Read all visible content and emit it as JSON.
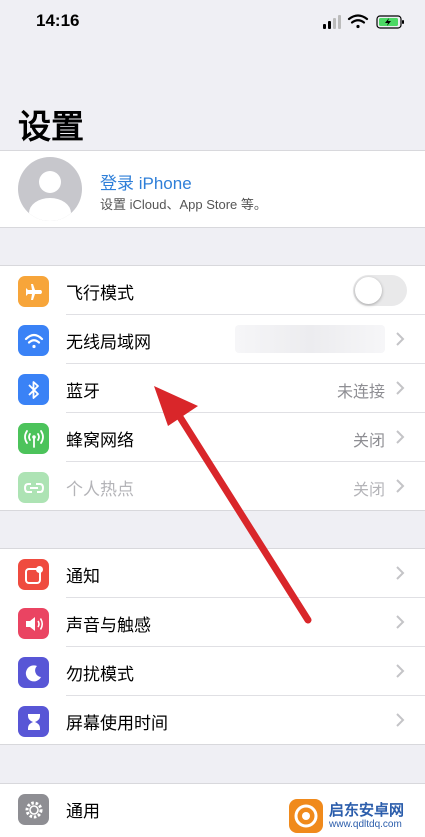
{
  "status": {
    "time": "14:16"
  },
  "page": {
    "title": "设置"
  },
  "profile": {
    "title": "登录 iPhone",
    "subtitle": "设置 iCloud、App Store 等。"
  },
  "group1": [
    {
      "label": "飞行模式",
      "icon": "airplane-icon",
      "color": "#f7a53a",
      "toggle": true
    },
    {
      "label": "无线局域网",
      "icon": "wifi-icon",
      "color": "#3a82f6",
      "value": ""
    },
    {
      "label": "蓝牙",
      "icon": "bluetooth-icon",
      "color": "#3a82f6",
      "value": "未连接"
    },
    {
      "label": "蜂窝网络",
      "icon": "antenna-icon",
      "color": "#4cc35b",
      "value": "关闭"
    },
    {
      "label": "个人热点",
      "icon": "hotspot-icon",
      "color": "#4cc35b",
      "value": "关闭",
      "disabled": true
    }
  ],
  "group2": [
    {
      "label": "通知",
      "icon": "notification-icon",
      "color": "#ef4b3f"
    },
    {
      "label": "声音与触感",
      "icon": "speaker-icon",
      "color": "#ea4462"
    },
    {
      "label": "勿扰模式",
      "icon": "moon-icon",
      "color": "#5856d6"
    },
    {
      "label": "屏幕使用时间",
      "icon": "hourglass-icon",
      "color": "#5856d6"
    }
  ],
  "group3": [
    {
      "label": "通用",
      "icon": "gear-icon",
      "color": "#8e8e93"
    }
  ],
  "watermark": {
    "name": "启东安卓网",
    "url": "www.qdltdq.com"
  },
  "annotation": {
    "arrow_color": "#d9262a"
  }
}
